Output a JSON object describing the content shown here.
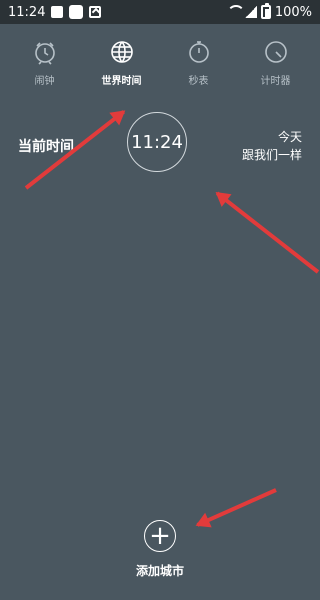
{
  "status": {
    "time": "11:24",
    "battery": "100%"
  },
  "nav": {
    "items": [
      {
        "label": "闹钟",
        "icon": "alarm-clock-icon",
        "active": false
      },
      {
        "label": "世界时间",
        "icon": "globe-icon",
        "active": true
      },
      {
        "label": "秒表",
        "icon": "stopwatch-icon",
        "active": false
      },
      {
        "label": "计时器",
        "icon": "timer-icon",
        "active": false
      }
    ]
  },
  "world_time": {
    "left_label": "当前时间",
    "clock_time": "11:24",
    "right_line1": "今天",
    "right_line2": "跟我们一样"
  },
  "add": {
    "label": "添加城市",
    "icon": "plus-icon"
  },
  "colors": {
    "background": "#4a5760",
    "status_bar": "#2b3236",
    "arrow": "#e23b3b"
  }
}
